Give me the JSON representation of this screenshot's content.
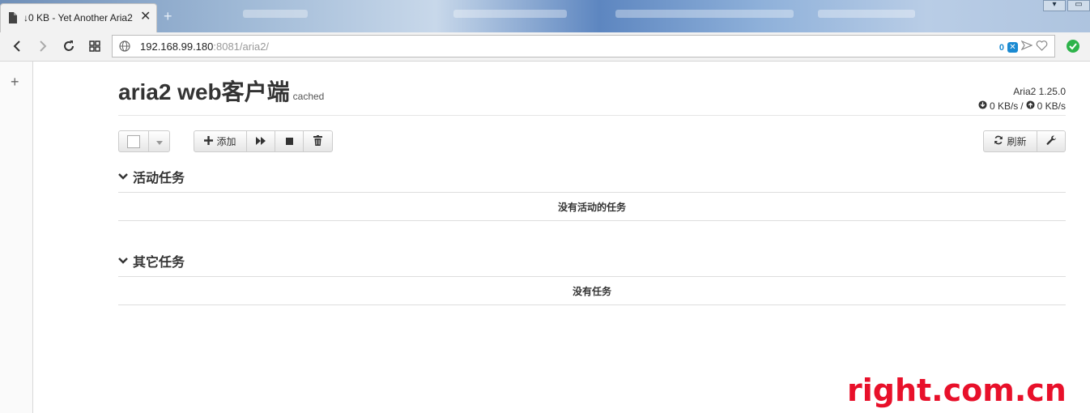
{
  "browser": {
    "tab_title": "↓0 KB - Yet Another Aria2",
    "new_tab_symbol": "+",
    "url_host": "192.168.99.180",
    "url_port_path": ":8081/aria2/",
    "extension_count": "0",
    "extension_badge": "✕"
  },
  "sidebar": {
    "plus": "+"
  },
  "header": {
    "title": "aria2 web客户端",
    "subtitle": "cached",
    "version": "Aria2 1.25.0",
    "download_speed": "0 KB/s",
    "speed_separator": "/",
    "upload_speed": "0 KB/s"
  },
  "toolbar": {
    "add_label": "添加",
    "refresh_label": "刷新"
  },
  "sections": {
    "active": {
      "title": "活动任务",
      "empty": "没有活动的任务"
    },
    "other": {
      "title": "其它任务",
      "empty": "没有任务"
    }
  },
  "watermark": "right.com.cn",
  "colors": {
    "accent": "#1a8ad2",
    "ok": "#2db34a",
    "watermark": "#e8102a"
  }
}
